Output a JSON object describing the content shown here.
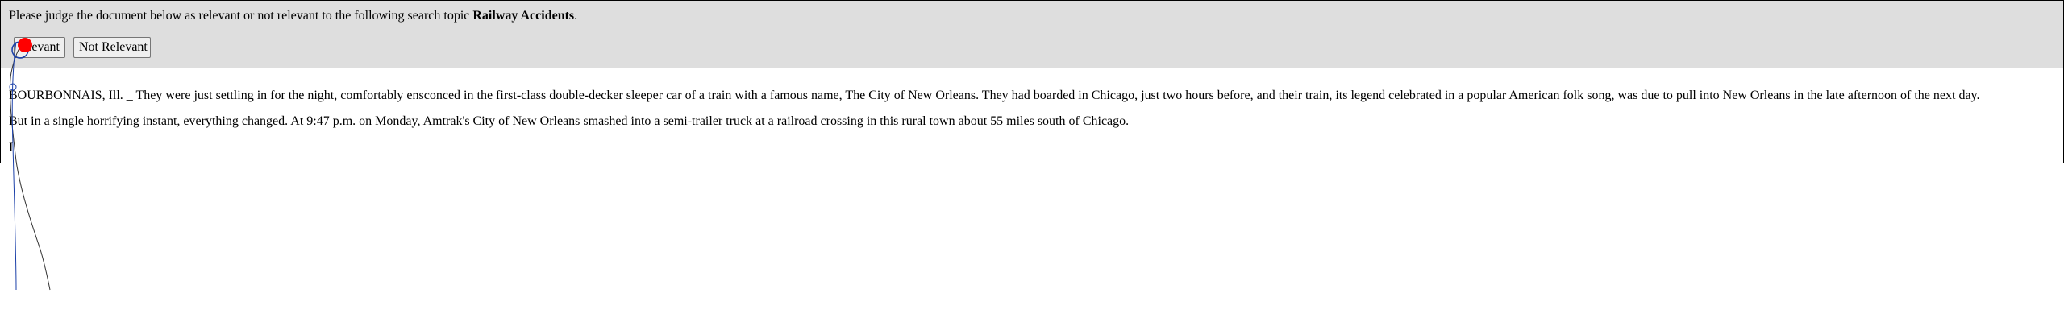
{
  "judge_panel": {
    "prompt_prefix": "Please judge the document below as relevant or not relevant to the following search topic ",
    "search_topic": "Railway Accidents",
    "prompt_suffix": ".",
    "relevant_label": "Relevant",
    "relevant_label_visible": "levant",
    "not_relevant_label": "Not Relevant"
  },
  "document": {
    "paragraphs": [
      "BOURBONNAIS, Ill. _ They were just settling in for the night, comfortably ensconced in the first-class double-decker sleeper car of a train with a famous name, The City of New Orleans. They had boarded in Chicago, just two hours before, and their train, its legend celebrated in a popular American folk song, was due to pull into New Orleans in the late afternoon of the next day.",
      "But in a single horrifying instant, everything changed. At 9:47 p.m. on Monday, Amtrak's City of New Orleans smashed into a semi-trailer truck at a railroad crossing in this rural town about 55 miles south of Chicago.",
      "I"
    ]
  },
  "overlay": {
    "cursor_color": "#ff0000",
    "trail_color": "#333333",
    "marker_color": "#1a3fa8"
  }
}
